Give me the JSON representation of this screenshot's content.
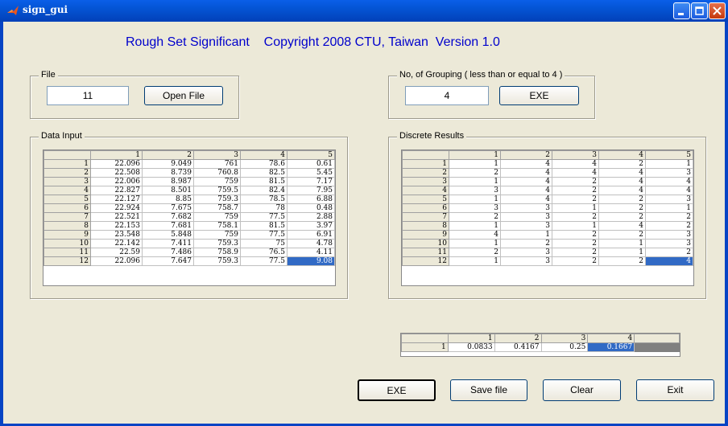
{
  "window": {
    "title": "sign_gui"
  },
  "heading": "Rough Set Significant    Copyright 2008 CTU, Taiwan  Version 1.0",
  "file_group": {
    "label": "File",
    "value": "11",
    "open_button": "Open File"
  },
  "grouping_group": {
    "label": "No, of Grouping ( less than or equal to 4 )",
    "value": "4",
    "exe_button": "EXE"
  },
  "data_input": {
    "label": "Data Input",
    "columns": [
      "1",
      "2",
      "3",
      "4",
      "5"
    ],
    "rows": [
      {
        "id": "1",
        "cells": [
          "22.096",
          "9.049",
          "761",
          "78.6",
          "0.61"
        ]
      },
      {
        "id": "2",
        "cells": [
          "22.508",
          "8.739",
          "760.8",
          "82.5",
          "5.45"
        ]
      },
      {
        "id": "3",
        "cells": [
          "22.006",
          "8.987",
          "759",
          "81.5",
          "7.17"
        ]
      },
      {
        "id": "4",
        "cells": [
          "22.827",
          "8.501",
          "759.5",
          "82.4",
          "7.95"
        ]
      },
      {
        "id": "5",
        "cells": [
          "22.127",
          "8.85",
          "759.3",
          "78.5",
          "6.88"
        ]
      },
      {
        "id": "6",
        "cells": [
          "22.924",
          "7.675",
          "758.7",
          "78",
          "0.48"
        ]
      },
      {
        "id": "7",
        "cells": [
          "22.521",
          "7.682",
          "759",
          "77.5",
          "2.88"
        ]
      },
      {
        "id": "8",
        "cells": [
          "22.153",
          "7.681",
          "758.1",
          "81.5",
          "3.97"
        ]
      },
      {
        "id": "9",
        "cells": [
          "23.548",
          "5.848",
          "759",
          "77.5",
          "6.91"
        ]
      },
      {
        "id": "10",
        "cells": [
          "22.142",
          "7.411",
          "759.3",
          "75",
          "4.78"
        ]
      },
      {
        "id": "11",
        "cells": [
          "22.59",
          "7.486",
          "758.9",
          "76.5",
          "4.11"
        ]
      },
      {
        "id": "12",
        "cells": [
          "22.096",
          "7.647",
          "759.3",
          "77.5",
          "9.08"
        ]
      }
    ]
  },
  "discrete_results": {
    "label": "Discrete Results",
    "columns": [
      "1",
      "2",
      "3",
      "4",
      "5"
    ],
    "rows": [
      {
        "id": "1",
        "cells": [
          "1",
          "4",
          "4",
          "2",
          "1"
        ]
      },
      {
        "id": "2",
        "cells": [
          "2",
          "4",
          "4",
          "4",
          "3"
        ]
      },
      {
        "id": "3",
        "cells": [
          "1",
          "4",
          "2",
          "4",
          "4"
        ]
      },
      {
        "id": "4",
        "cells": [
          "3",
          "4",
          "2",
          "4",
          "4"
        ]
      },
      {
        "id": "5",
        "cells": [
          "1",
          "4",
          "2",
          "2",
          "3"
        ]
      },
      {
        "id": "6",
        "cells": [
          "3",
          "3",
          "1",
          "2",
          "1"
        ]
      },
      {
        "id": "7",
        "cells": [
          "2",
          "3",
          "2",
          "2",
          "2"
        ]
      },
      {
        "id": "8",
        "cells": [
          "1",
          "3",
          "1",
          "4",
          "2"
        ]
      },
      {
        "id": "9",
        "cells": [
          "4",
          "1",
          "2",
          "2",
          "3"
        ]
      },
      {
        "id": "10",
        "cells": [
          "1",
          "2",
          "2",
          "1",
          "3"
        ]
      },
      {
        "id": "11",
        "cells": [
          "2",
          "3",
          "2",
          "1",
          "2"
        ]
      },
      {
        "id": "12",
        "cells": [
          "1",
          "3",
          "2",
          "2",
          "4"
        ]
      }
    ]
  },
  "significance": {
    "columns": [
      "1",
      "2",
      "3",
      "4"
    ],
    "rows": [
      {
        "id": "1",
        "cells": [
          "0.0833",
          "0.4167",
          "0.25",
          "0.1667"
        ]
      }
    ]
  },
  "buttons": {
    "exe": "EXE",
    "save": "Save file",
    "clear": "Clear",
    "exit": "Exit"
  },
  "colors": {
    "heading": "#0000cc",
    "selection": "#316ac5",
    "titlebar": "#0454d4"
  }
}
